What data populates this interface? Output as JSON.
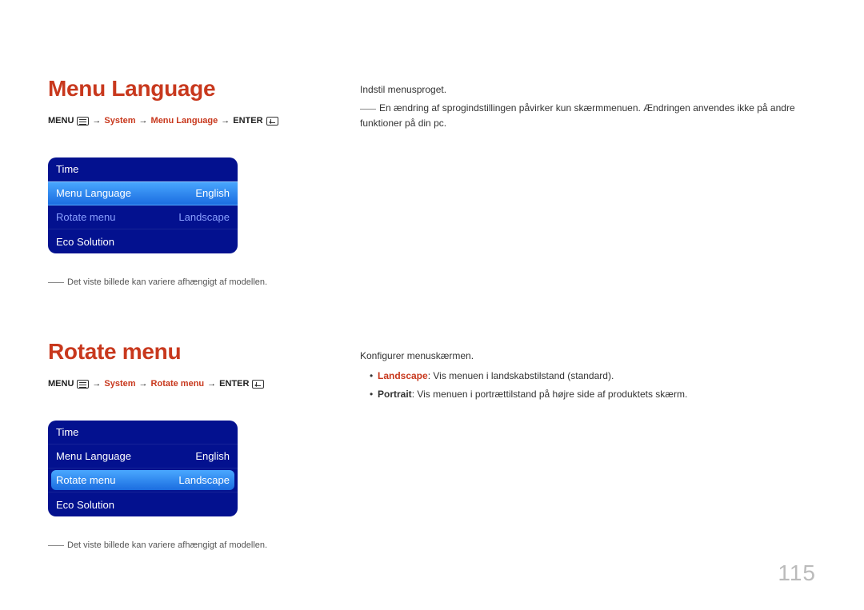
{
  "page_number": "115",
  "section1": {
    "heading": "Menu Language",
    "breadcrumb": {
      "menu": "MENU",
      "system": "System",
      "item": "Menu Language",
      "enter": "ENTER"
    },
    "menu": {
      "row0": {
        "label": "Time",
        "value": ""
      },
      "row1": {
        "label": "Menu Language",
        "value": "English"
      },
      "row2": {
        "label": "Rotate menu",
        "value": "Landscape"
      },
      "row3": {
        "label": "Eco Solution",
        "value": ""
      }
    },
    "note": "Det viste billede kan variere afhængigt af modellen.",
    "right": {
      "p1": "Indstil menusproget.",
      "p2": "En ændring af sprogindstillingen påvirker kun skærmmenuen. Ændringen anvendes ikke på andre funktioner på din pc."
    }
  },
  "section2": {
    "heading": "Rotate menu",
    "breadcrumb": {
      "menu": "MENU",
      "system": "System",
      "item": "Rotate menu",
      "enter": "ENTER"
    },
    "menu": {
      "row0": {
        "label": "Time",
        "value": ""
      },
      "row1": {
        "label": "Menu Language",
        "value": "English"
      },
      "row2": {
        "label": "Rotate menu",
        "value": "Landscape"
      },
      "row3": {
        "label": "Eco Solution",
        "value": ""
      }
    },
    "note": "Det viste billede kan variere afhængigt af modellen.",
    "right": {
      "p1": "Konfigurer menuskærmen.",
      "bullets": {
        "b1_kw": "Landscape",
        "b1_txt": ": Vis menuen i landskabstilstand (standard).",
        "b2_kw": "Portrait",
        "b2_txt": ": Vis menuen i portrættilstand på højre side af produktets skærm."
      }
    }
  }
}
